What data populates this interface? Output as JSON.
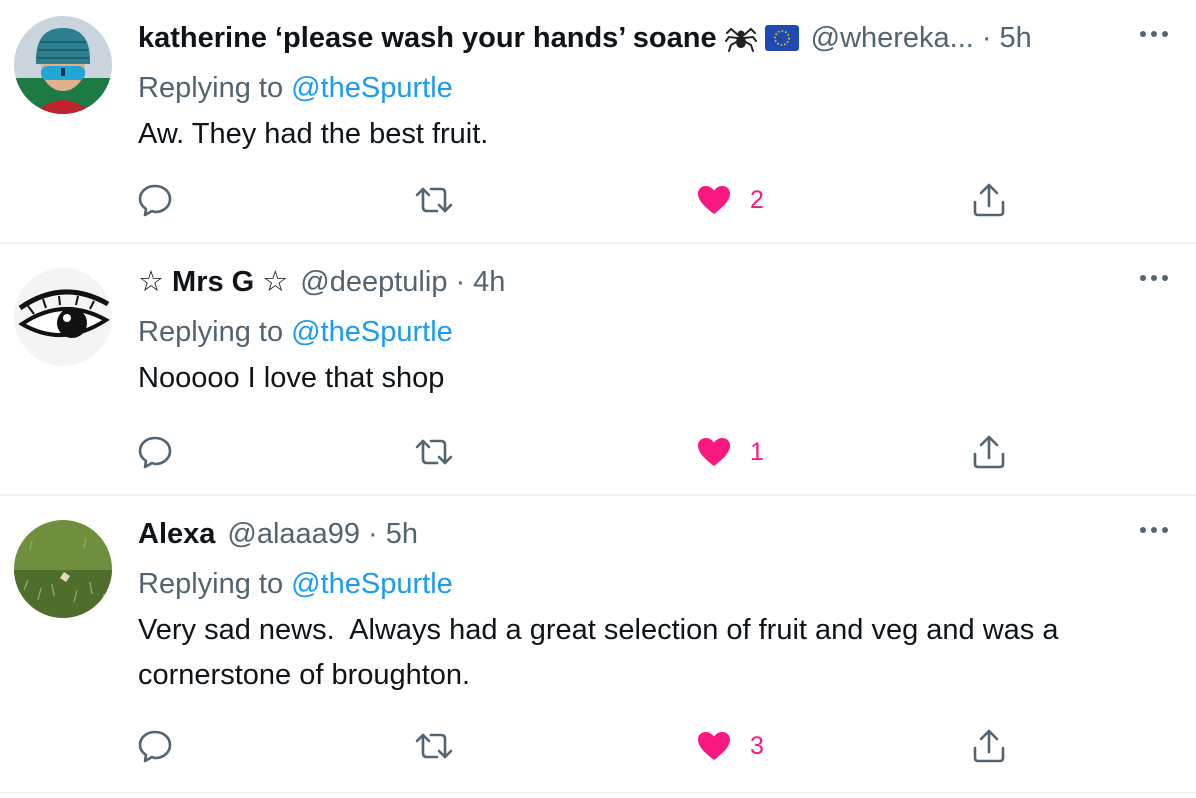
{
  "colors": {
    "text": "#0f1419",
    "secondary": "#536471",
    "link": "#1d9bf0",
    "like": "#f91880",
    "divider": "#eff3f4"
  },
  "replying_label": "Replying to",
  "replies": [
    {
      "name": "katherine ‘please wash your hands’ soane",
      "name_emoji": [
        "spider-emoji",
        "eu-flag-emoji"
      ],
      "handle": "@whereka...",
      "dot": "·",
      "time": "5h",
      "reply_to": "@theSpurtle",
      "text": "Aw. They had the best fruit.",
      "like_count": "2",
      "liked": true
    },
    {
      "name": "☆ Mrs G ☆",
      "handle": "@deeptulip",
      "dot": "·",
      "time": "4h",
      "reply_to": "@theSpurtle",
      "text": "Nooooo I love that shop",
      "like_count": "1",
      "liked": true
    },
    {
      "name": "Alexa",
      "handle": "@alaaa99",
      "dot": "·",
      "time": "5h",
      "reply_to": "@theSpurtle",
      "text": "Very sad news.  Always had a great selection of fruit and veg and was a cornerstone of broughton.",
      "like_count": "3",
      "liked": true
    }
  ]
}
